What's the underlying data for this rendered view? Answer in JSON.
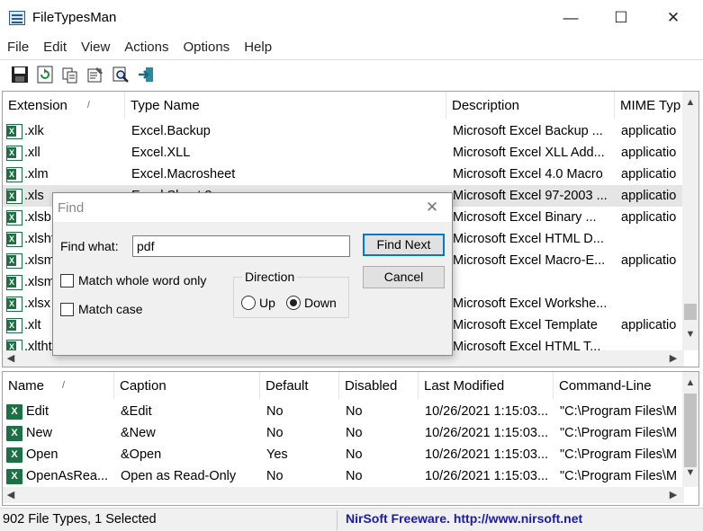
{
  "window": {
    "title": "FileTypesMan",
    "minimize": "—",
    "maximize": "☐",
    "close": "✕"
  },
  "menu": [
    "File",
    "Edit",
    "View",
    "Actions",
    "Options",
    "Help"
  ],
  "toolbar": [
    "save-icon",
    "refresh-icon",
    "copy-icon",
    "properties-icon",
    "find-icon",
    "exit-icon"
  ],
  "file_types": {
    "columns": [
      "Extension",
      "Type Name",
      "Description",
      "MIME Typ"
    ],
    "sort_indicator": "/",
    "rows": [
      {
        "ext": ".xlk",
        "type": "Excel.Backup",
        "desc": "Microsoft Excel Backup ...",
        "mime": "applicatio"
      },
      {
        "ext": ".xll",
        "type": "Excel.XLL",
        "desc": "Microsoft Excel XLL Add...",
        "mime": "applicatio"
      },
      {
        "ext": ".xlm",
        "type": "Excel.Macrosheet",
        "desc": "Microsoft Excel 4.0 Macro",
        "mime": "applicatio"
      },
      {
        "ext": ".xls",
        "type": "Excel.Sheet.8",
        "desc": "Microsoft Excel 97-2003 ...",
        "mime": "applicatio",
        "selected": true
      },
      {
        "ext": ".xlsb",
        "type": "",
        "desc": "Microsoft Excel Binary ...",
        "mime": "applicatio"
      },
      {
        "ext": ".xlsht",
        "type": "",
        "desc": "Microsoft Excel HTML D...",
        "mime": ""
      },
      {
        "ext": ".xlsm",
        "type": "",
        "desc": "Microsoft Excel Macro-E...",
        "mime": "applicatio"
      },
      {
        "ext": ".xlsm",
        "type": "",
        "desc": "",
        "mime": ""
      },
      {
        "ext": ".xlsx",
        "type": "",
        "desc": "Microsoft Excel Workshe...",
        "mime": ""
      },
      {
        "ext": ".xlt",
        "type": "",
        "desc": "Microsoft Excel Template",
        "mime": "applicatio"
      },
      {
        "ext": ".xltht",
        "type": "",
        "desc": "Microsoft Excel HTML T...",
        "mime": ""
      }
    ]
  },
  "actions": {
    "columns": [
      "Name",
      "Caption",
      "Default",
      "Disabled",
      "Last Modified",
      "Command-Line"
    ],
    "sort_indicator": "/",
    "rows": [
      {
        "name": "Edit",
        "caption": "&Edit",
        "default": "No",
        "disabled": "No",
        "modified": "10/26/2021 1:15:03...",
        "cmd": "\"C:\\Program Files\\M"
      },
      {
        "name": "New",
        "caption": "&New",
        "default": "No",
        "disabled": "No",
        "modified": "10/26/2021 1:15:03...",
        "cmd": "\"C:\\Program Files\\M"
      },
      {
        "name": "Open",
        "caption": "&Open",
        "default": "Yes",
        "disabled": "No",
        "modified": "10/26/2021 1:15:03...",
        "cmd": "\"C:\\Program Files\\M"
      },
      {
        "name": "OpenAsRea...",
        "caption": "Open as Read-Only",
        "default": "No",
        "disabled": "No",
        "modified": "10/26/2021 1:15:03...",
        "cmd": "\"C:\\Program Files\\M"
      }
    ]
  },
  "status": {
    "left": "902 File Types, 1 Selected",
    "link": "NirSoft Freeware.  http://www.nirsoft.net"
  },
  "find_dialog": {
    "title": "Find",
    "close": "✕",
    "find_what_label": "Find what:",
    "find_what_value": "pdf",
    "find_next": "Find Next",
    "cancel": "Cancel",
    "match_whole_word": "Match whole word only",
    "match_case": "Match case",
    "direction_label": "Direction",
    "up": "Up",
    "down": "Down",
    "direction_selected": "Down",
    "match_whole_word_checked": false,
    "match_case_checked": false
  },
  "colors": {
    "excel_green": "#1d7044",
    "selection": "#e5e5e5",
    "link": "#1a1ab0",
    "focus": "#0078d7"
  }
}
